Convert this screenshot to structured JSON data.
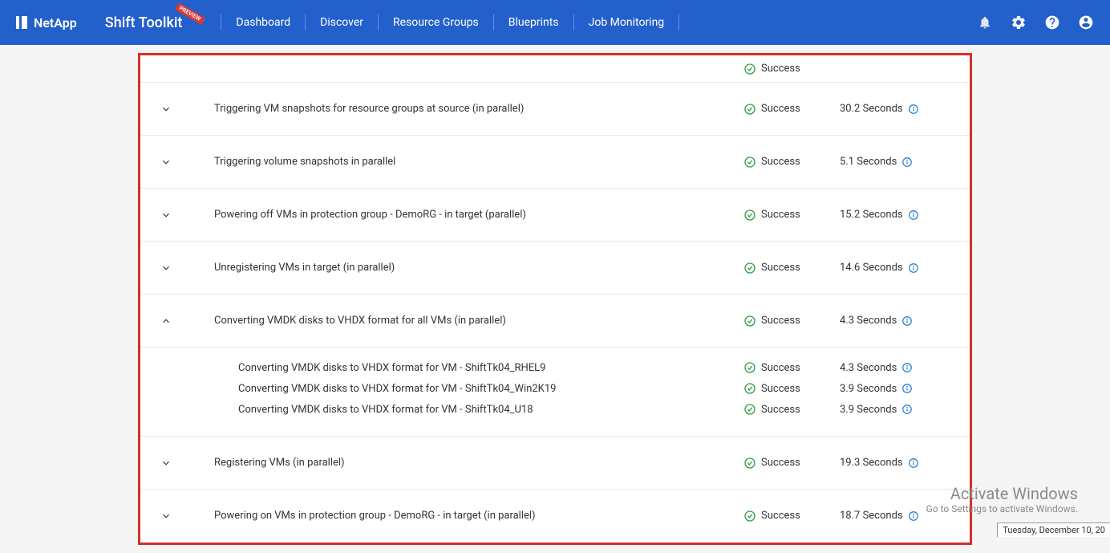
{
  "header": {
    "company": "NetApp",
    "appTitle": "Shift Toolkit",
    "badge": "PREVIEW",
    "nav": [
      "Dashboard",
      "Discover",
      "Resource Groups",
      "Blueprints",
      "Job Monitoring"
    ]
  },
  "tasks": [
    {
      "label": "Triggering VM snapshots for resource groups at source (in parallel)",
      "status": "Success",
      "duration": "30.2 Seconds",
      "expanded": false
    },
    {
      "label": "Triggering volume snapshots in parallel",
      "status": "Success",
      "duration": "5.1 Seconds",
      "expanded": false
    },
    {
      "label": "Powering off VMs in protection group - DemoRG - in target (parallel)",
      "status": "Success",
      "duration": "15.2 Seconds",
      "expanded": false
    },
    {
      "label": "Unregistering VMs in target (in parallel)",
      "status": "Success",
      "duration": "14.6 Seconds",
      "expanded": false
    },
    {
      "label": "Converting VMDK disks to VHDX format for all VMs (in parallel)",
      "status": "Success",
      "duration": "4.3 Seconds",
      "expanded": true,
      "children": [
        {
          "label": "Converting VMDK disks to VHDX format for VM - ShiftTk04_RHEL9",
          "status": "Success",
          "duration": "4.3 Seconds"
        },
        {
          "label": "Converting VMDK disks to VHDX format for VM - ShiftTk04_Win2K19",
          "status": "Success",
          "duration": "3.9 Seconds"
        },
        {
          "label": "Converting VMDK disks to VHDX format for VM - ShiftTk04_U18",
          "status": "Success",
          "duration": "3.9 Seconds"
        }
      ]
    },
    {
      "label": "Registering VMs (in parallel)",
      "status": "Success",
      "duration": "19.3 Seconds",
      "expanded": false
    },
    {
      "label": "Powering on VMs in protection group - DemoRG - in target (in parallel)",
      "status": "Success",
      "duration": "18.7 Seconds",
      "expanded": false
    }
  ],
  "watermark": {
    "title": "Activate Windows",
    "sub": "Go to Settings to activate Windows."
  },
  "dateChip": "Tuesday, December 10, 20",
  "partialRow": {
    "status": "Success"
  }
}
